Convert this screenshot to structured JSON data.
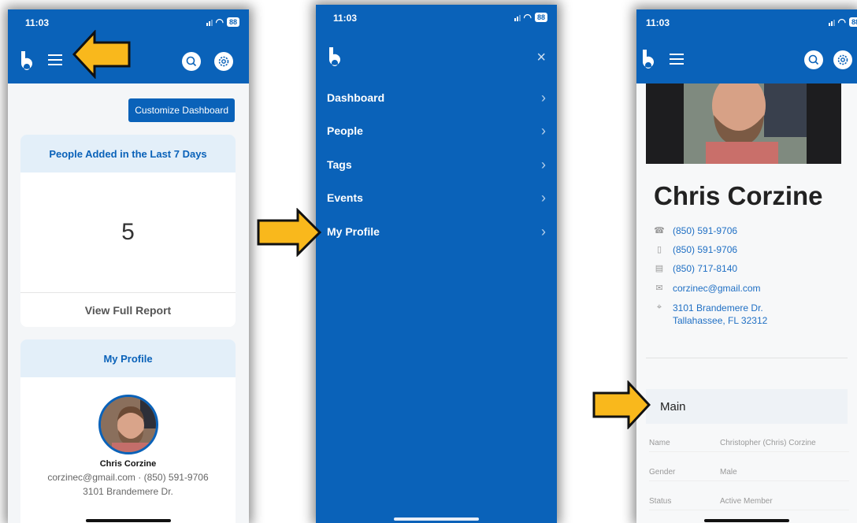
{
  "status_bar": {
    "time": "11:03",
    "battery": "88"
  },
  "dashboard": {
    "customize_label": "Customize Dashboard",
    "people_card": {
      "title": "People Added in the Last 7 Days",
      "value": "5",
      "link": "View Full Report"
    },
    "profile_card": {
      "title": "My Profile",
      "name": "Chris Corzine",
      "contact": "corzinec@gmail.com · (850) 591-9706",
      "address": "3101 Brandemere Dr."
    }
  },
  "menu": {
    "items": [
      {
        "label": "Dashboard"
      },
      {
        "label": "People"
      },
      {
        "label": "Tags"
      },
      {
        "label": "Events"
      },
      {
        "label": "My Profile"
      }
    ],
    "close_icon": "×"
  },
  "profile": {
    "name": "Chris Corzine",
    "contacts": [
      {
        "icon": "phone-icon",
        "text": "(850) 591-9706"
      },
      {
        "icon": "mobile-icon",
        "text": "(850) 591-9706"
      },
      {
        "icon": "briefcase-icon",
        "text": "(850) 717-8140"
      },
      {
        "icon": "email-icon",
        "text": "corzinec@gmail.com"
      },
      {
        "icon": "location-icon",
        "text": "3101 Brandemere Dr.",
        "text2": "Tallahassee, FL 32312"
      }
    ],
    "section_title": "Main",
    "fields": [
      {
        "label": "Name",
        "value": "Christopher (Chris) Corzine"
      },
      {
        "label": "Gender",
        "value": "Male"
      },
      {
        "label": "Status",
        "value": "Active Member"
      }
    ]
  },
  "colors": {
    "primary": "#0a62b9",
    "highlight_arrow": "#f9b81c"
  }
}
